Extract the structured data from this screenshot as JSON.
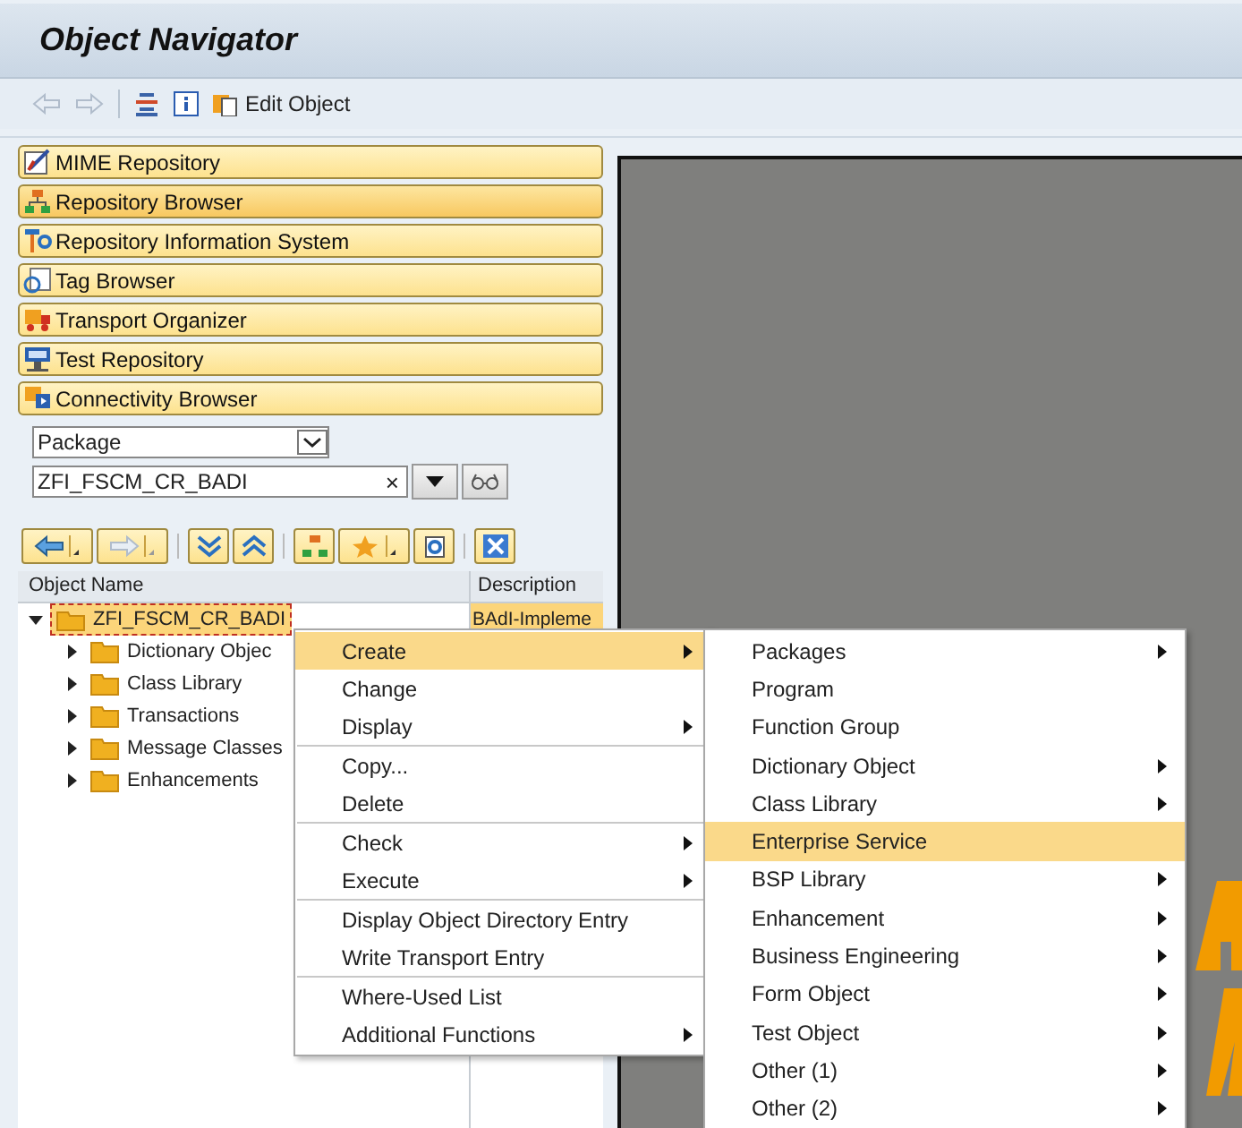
{
  "window": {
    "title": "Object Navigator"
  },
  "toolbar": {
    "edit_button": "Edit Object"
  },
  "nav_buttons": [
    {
      "label": "MIME Repository",
      "selected": false
    },
    {
      "label": "Repository Browser",
      "selected": true
    },
    {
      "label": "Repository Information System",
      "selected": false
    },
    {
      "label": "Tag Browser",
      "selected": false
    },
    {
      "label": "Transport Organizer",
      "selected": false
    },
    {
      "label": "Test Repository",
      "selected": false
    },
    {
      "label": "Connectivity Browser",
      "selected": false
    }
  ],
  "object_selector": {
    "type": "Package",
    "value": "ZFI_FSCM_CR_BADI",
    "clear": "×"
  },
  "tree": {
    "columns": [
      "Object Name",
      "Description"
    ],
    "nodes": [
      {
        "name": "ZFI_FSCM_CR_BADI",
        "description": "BAdI-Impleme",
        "expanded": true,
        "selected": true,
        "children": [
          {
            "name": "Dictionary Objec",
            "expanded": false,
            "selected": false
          },
          {
            "name": "Class Library",
            "expanded": false,
            "selected": false
          },
          {
            "name": "Transactions",
            "expanded": false,
            "selected": false
          },
          {
            "name": "Message Classes",
            "expanded": false,
            "selected": false
          },
          {
            "name": "Enhancements",
            "expanded": false,
            "selected": false
          }
        ]
      }
    ]
  },
  "context_menu": {
    "groups": [
      [
        {
          "label": "Create",
          "submenu": true,
          "selected": true
        },
        {
          "label": "Change",
          "submenu": false,
          "selected": false
        },
        {
          "label": "Display",
          "submenu": true,
          "selected": false
        }
      ],
      [
        {
          "label": "Copy...",
          "submenu": false,
          "selected": false
        },
        {
          "label": "Delete",
          "submenu": false,
          "selected": false
        }
      ],
      [
        {
          "label": "Check",
          "submenu": true,
          "selected": false
        },
        {
          "label": "Execute",
          "submenu": true,
          "selected": false
        }
      ],
      [
        {
          "label": "Display Object Directory Entry",
          "submenu": false,
          "selected": false
        },
        {
          "label": "Write Transport Entry",
          "submenu": false,
          "selected": false
        }
      ],
      [
        {
          "label": "Where-Used List",
          "submenu": false,
          "selected": false
        },
        {
          "label": "Additional Functions",
          "submenu": true,
          "selected": false
        }
      ]
    ]
  },
  "create_submenu": {
    "items": [
      {
        "label": "Packages",
        "submenu": true,
        "selected": false
      },
      {
        "label": "Program",
        "submenu": false,
        "selected": false
      },
      {
        "label": "Function Group",
        "submenu": false,
        "selected": false
      },
      {
        "label": "Dictionary Object",
        "submenu": true,
        "selected": false
      },
      {
        "label": "Class Library",
        "submenu": true,
        "selected": false
      },
      {
        "label": "Enterprise Service",
        "submenu": false,
        "selected": true
      },
      {
        "label": "BSP Library",
        "submenu": true,
        "selected": false
      },
      {
        "label": "Enhancement",
        "submenu": true,
        "selected": false
      },
      {
        "label": "Business Engineering",
        "submenu": true,
        "selected": false
      },
      {
        "label": "Form Object",
        "submenu": true,
        "selected": false
      },
      {
        "label": "Test Object",
        "submenu": true,
        "selected": false
      },
      {
        "label": "Other (1)",
        "submenu": true,
        "selected": false
      },
      {
        "label": "Other (2)",
        "submenu": true,
        "selected": false
      }
    ]
  }
}
